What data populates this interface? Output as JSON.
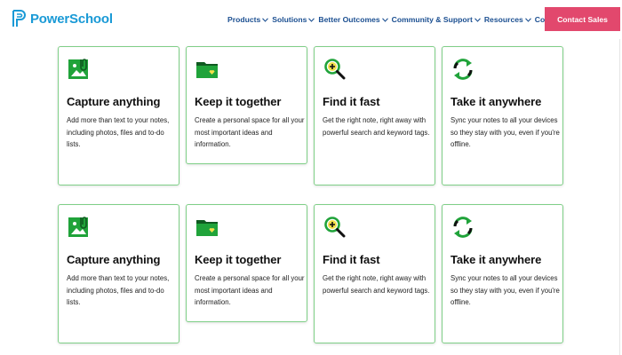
{
  "header": {
    "logo_text": "PowerSchool",
    "nav": [
      {
        "label": "Products"
      },
      {
        "label": "Solutions"
      },
      {
        "label": "Better Outcomes"
      },
      {
        "label": "Community & Support"
      },
      {
        "label": "Resources"
      },
      {
        "label": "Company"
      }
    ],
    "cta_label": "Contact Sales"
  },
  "colors": {
    "brand_blue": "#1a9ad6",
    "nav_blue": "#1b4f91",
    "cta_pink": "#e2486d",
    "card_border_green": "#7fcf87",
    "icon_green": "#20a33a"
  },
  "rows": [
    {
      "cards": [
        {
          "icon": "attachment-photo-icon",
          "title": "Capture anything",
          "desc": "Add more than text to your notes, including photos, files and to-do lists."
        },
        {
          "icon": "folder-heart-icon",
          "title": "Keep it together",
          "desc": "Create a personal space for all your most important ideas and information."
        },
        {
          "icon": "search-plus-icon",
          "title": "Find it fast",
          "desc": "Get the right note, right away with powerful search and keyword tags."
        },
        {
          "icon": "sync-icon",
          "title": "Take it anywhere",
          "desc": "Sync your notes to all your devices so they stay with you, even if you're offline."
        }
      ]
    },
    {
      "cards": [
        {
          "icon": "attachment-photo-icon",
          "title": "Capture anything",
          "desc": "Add more than text to your notes, including photos, files and to-do lists."
        },
        {
          "icon": "folder-heart-icon",
          "title": "Keep it together",
          "desc": "Create a personal space for all your most important ideas and information."
        },
        {
          "icon": "search-plus-icon",
          "title": "Find it fast",
          "desc": "Get the right note, right away with powerful search and keyword tags."
        },
        {
          "icon": "sync-icon",
          "title": "Take it anywhere",
          "desc": "Sync your notes to all your devices so they stay with you, even if you're offline."
        }
      ]
    }
  ]
}
